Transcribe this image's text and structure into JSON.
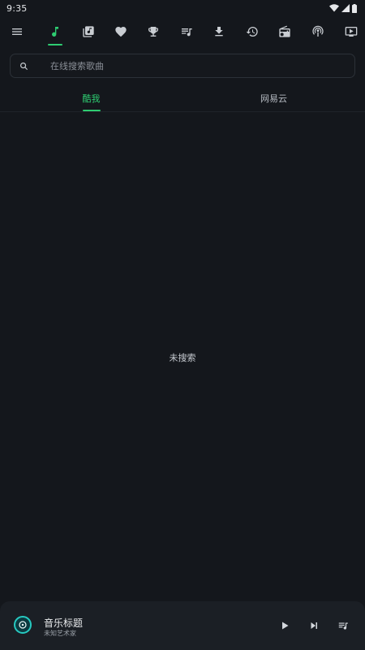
{
  "status_bar": {
    "time": "9:35",
    "icons": [
      "wifi-icon",
      "signal-icon",
      "battery-icon"
    ]
  },
  "toolbar": {
    "active_index": 1,
    "accent_color": "#2ecc71",
    "items": [
      "menu-icon",
      "music-note-icon",
      "library-icon",
      "heart-icon",
      "trophy-icon",
      "playlist-icon",
      "download-icon",
      "history-icon",
      "radio-icon",
      "podcast-icon",
      "video-icon"
    ]
  },
  "search": {
    "placeholder": "在线搜索歌曲",
    "value": ""
  },
  "tabs": [
    {
      "label": "酷我",
      "active": true
    },
    {
      "label": "网易云",
      "active": false
    }
  ],
  "content": {
    "empty_message": "未搜索"
  },
  "player": {
    "title": "音乐标题",
    "artist": "未知艺术家",
    "controls": [
      "play-icon",
      "skip-next-icon",
      "queue-icon"
    ]
  }
}
